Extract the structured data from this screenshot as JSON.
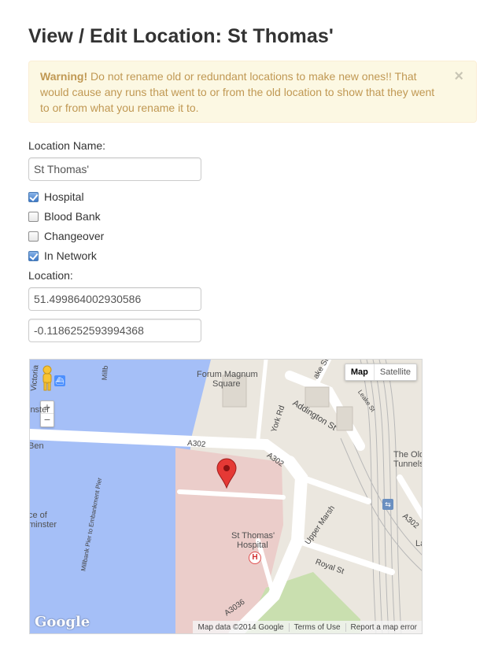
{
  "page_title": "View / Edit Location: St Thomas'",
  "warning": {
    "strong": "Warning!",
    "text": " Do not rename old or redundant locations to make new ones!! That would cause any runs that went to or from the old location to show that they went to or from what you rename it to.",
    "close_glyph": "×"
  },
  "form": {
    "name_label": "Location Name:",
    "name_value": "St Thomas'",
    "checkboxes": [
      {
        "label": "Hospital",
        "checked": true
      },
      {
        "label": "Blood Bank",
        "checked": false
      },
      {
        "label": "Changeover",
        "checked": false
      },
      {
        "label": "In Network",
        "checked": true
      }
    ],
    "location_label": "Location:",
    "latitude": "51.499864002930586",
    "longitude": "-0.1186252593994368"
  },
  "map": {
    "type_buttons": {
      "map": "Map",
      "satellite": "Satellite"
    },
    "zoom": {
      "in": "+",
      "out": "−"
    },
    "labels": {
      "forum": "Forum Magnum",
      "square": "Square",
      "addington": "Addington St",
      "york_rd": "York Rd",
      "a302_left": "A302",
      "a302_mid": "A302",
      "a302_right": "A302",
      "hospital_1": "St Thomas'",
      "hospital_2": "Hospital",
      "upper_marsh": "Upper Marsh",
      "royal_st": "Royal St",
      "pier": "Millbank Pier to Embankment Pier",
      "millb": "Millb",
      "victoria": "Victoria",
      "inster": "inster",
      "ben": "Ben",
      "ce_of": "ce of",
      "minster": "minster",
      "lake_st": "ake St",
      "leake_st": "Leake St",
      "old_1": "The Old",
      "old_2": "Tunnels",
      "la": "La",
      "a3036": "A3036"
    },
    "google": "Google",
    "footer": {
      "data": "Map data ©2014 Google",
      "terms": "Terms of Use",
      "report": "Report a map error"
    },
    "icons": {
      "pegman": "pegman-icon",
      "marker": "map-marker-icon",
      "hospital": "hospital-icon",
      "ferry": "ferry-icon",
      "rail": "rail-icon"
    },
    "colors": {
      "water": "#a5bff7",
      "land": "#ebe7df",
      "hospital_area": "#ebcdca",
      "park": "#c9dfaf",
      "road": "#ffffff",
      "marker": "#e53935"
    }
  }
}
